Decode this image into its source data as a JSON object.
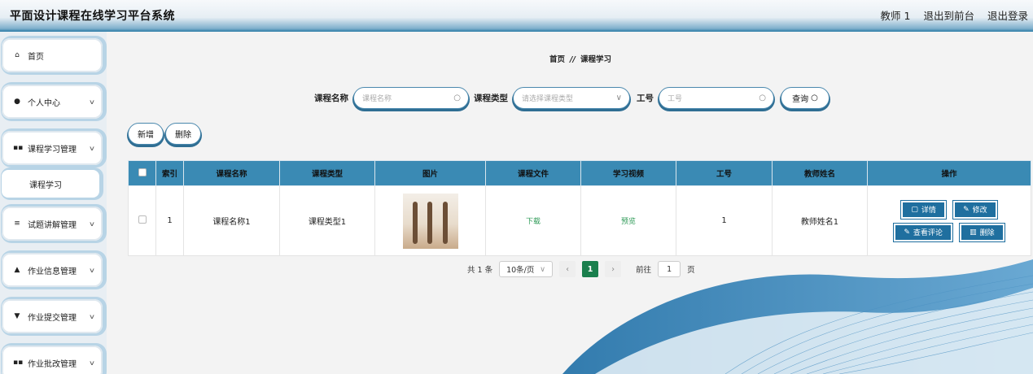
{
  "header": {
    "title": "平面设计课程在线学习平台系统",
    "user": "教师 1",
    "front_link": "退出到前台",
    "logout_link": "退出登录"
  },
  "sidebar": {
    "items": [
      {
        "label": "首页",
        "icon": "home-icon"
      },
      {
        "label": "个人中心",
        "icon": "user-icon"
      },
      {
        "label": "课程学习管理",
        "icon": "grid-icon"
      },
      {
        "label": "试题讲解管理",
        "icon": "list-icon"
      },
      {
        "label": "作业信息管理",
        "icon": "person-icon"
      },
      {
        "label": "作业提交管理",
        "icon": "pin-icon"
      },
      {
        "label": "作业批改管理",
        "icon": "grid-icon"
      }
    ],
    "subitem": "课程学习"
  },
  "breadcrumb": {
    "home": "首页",
    "sep": "//",
    "current": "课程学习"
  },
  "search": {
    "course_name_label": "课程名称",
    "course_name_placeholder": "课程名称",
    "course_type_label": "课程类型",
    "course_type_placeholder": "请选择课程类型",
    "job_no_label": "工号",
    "job_no_placeholder": "工号",
    "query_button": "查询"
  },
  "actions": {
    "add": "新增",
    "delete": "删除"
  },
  "table": {
    "headers": [
      "",
      "索引",
      "课程名称",
      "课程类型",
      "图片",
      "课程文件",
      "学习视频",
      "工号",
      "教师姓名",
      "操作"
    ],
    "rows": [
      {
        "index": "1",
        "course_name": "课程名称1",
        "course_type": "课程类型1",
        "file": "下载",
        "video": "预览",
        "job_no": "1",
        "teacher": "教师姓名1"
      }
    ],
    "ops": {
      "detail": "详情",
      "edit": "修改",
      "comments": "查看评论",
      "delete": "删除"
    }
  },
  "pagination": {
    "total": "共 1 条",
    "page_size": "10条/页",
    "current_page": "1",
    "goto_label": "前往",
    "goto_value": "1",
    "page_unit": "页"
  },
  "colors": {
    "header_blue": "#2a7aa6",
    "table_header": "#3a8ab4",
    "button_blue": "#1f6f9f",
    "active_page": "#1a7f4d"
  }
}
